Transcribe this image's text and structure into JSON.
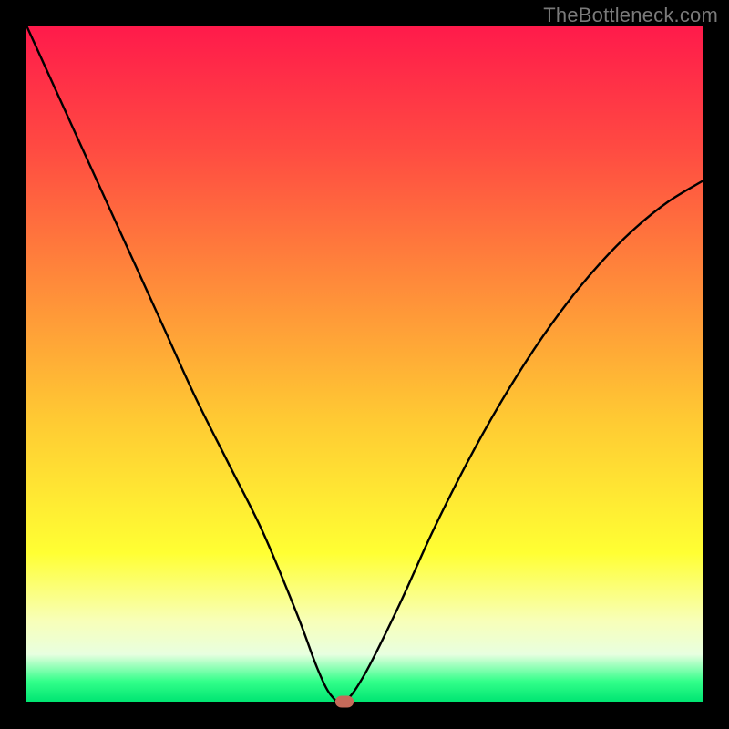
{
  "watermark": "TheBottleneck.com",
  "chart_data": {
    "type": "line",
    "title": "",
    "xlabel": "",
    "ylabel": "",
    "xlim": [
      0,
      100
    ],
    "ylim": [
      0,
      100
    ],
    "grid": false,
    "background_gradient": {
      "top": "#ff1a4b",
      "middle": "#ffff33",
      "bottom": "#00e572"
    },
    "series": [
      {
        "name": "bottleneck-curve",
        "color": "#000000",
        "x": [
          0,
          5,
          10,
          15,
          20,
          25,
          30,
          35,
          40,
          43,
          45,
          47,
          50,
          55,
          60,
          65,
          70,
          75,
          80,
          85,
          90,
          95,
          100
        ],
        "y": [
          100,
          89,
          78,
          67,
          56,
          45,
          35,
          25,
          13,
          5,
          1,
          0,
          4,
          14,
          25,
          35,
          44,
          52,
          59,
          65,
          70,
          74,
          77
        ]
      }
    ],
    "marker": {
      "name": "optimum-point",
      "x": 47,
      "y": 0,
      "color": "#c66a5a"
    }
  }
}
